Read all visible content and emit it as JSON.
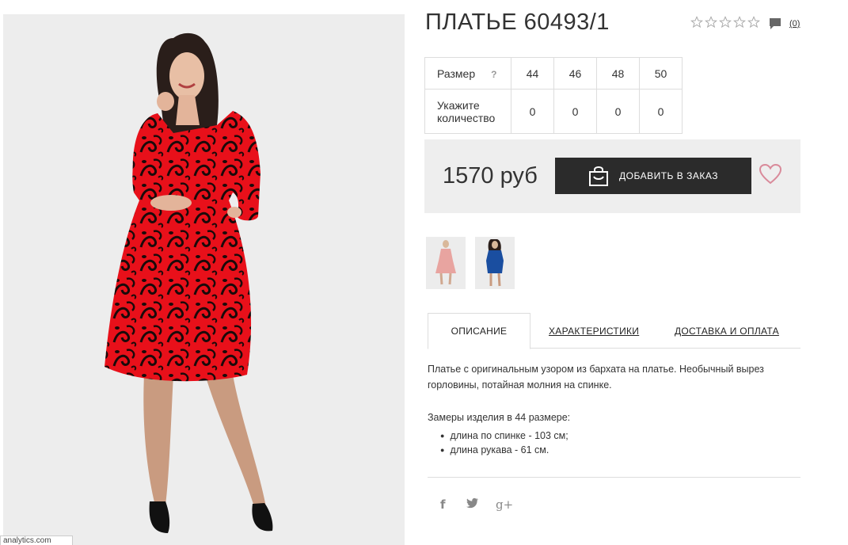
{
  "product": {
    "title": "ПЛАТЬЕ 60493/1",
    "rating_stars": 0,
    "rating_max": 5,
    "comments_count": "(0)"
  },
  "sizes": {
    "size_label": "Размер",
    "help_mark": "?",
    "qty_label": "Укажите количество",
    "values": [
      "44",
      "46",
      "48",
      "50"
    ],
    "quantities": [
      "0",
      "0",
      "0",
      "0"
    ]
  },
  "buy": {
    "price": "1570 руб",
    "add_label": "ДОБАВИТЬ В ЗАКАЗ"
  },
  "thumbnails": [
    {
      "color": "#e8a4a0"
    },
    {
      "color": "#1a4ea0"
    }
  ],
  "tabs": [
    {
      "label": "ОПИСАНИЕ",
      "active": true
    },
    {
      "label": "ХАРАКТЕРИСТИКИ",
      "active": false
    },
    {
      "label": "ДОСТАВКА И ОПЛАТА",
      "active": false
    }
  ],
  "description": {
    "text": "Платье с оригинальным узором из бархата на платье. Необычный вырез горловины, потайная молния на спинке.",
    "measure_title": "Замеры изделия в 44 размере:",
    "measures": [
      "длина по спинке - 103 см;",
      "длина рукава - 61 см."
    ]
  },
  "social": {
    "facebook": "f",
    "twitter": "t",
    "googleplus": "g+"
  },
  "footer": {
    "analytics_text": "analytics.com"
  },
  "colors": {
    "dress": "#e8101a",
    "pattern": "#1a0a0a",
    "button_bg": "#2b2b2b",
    "heart": "#d98a9a",
    "panel_bg": "#eeeeee"
  }
}
